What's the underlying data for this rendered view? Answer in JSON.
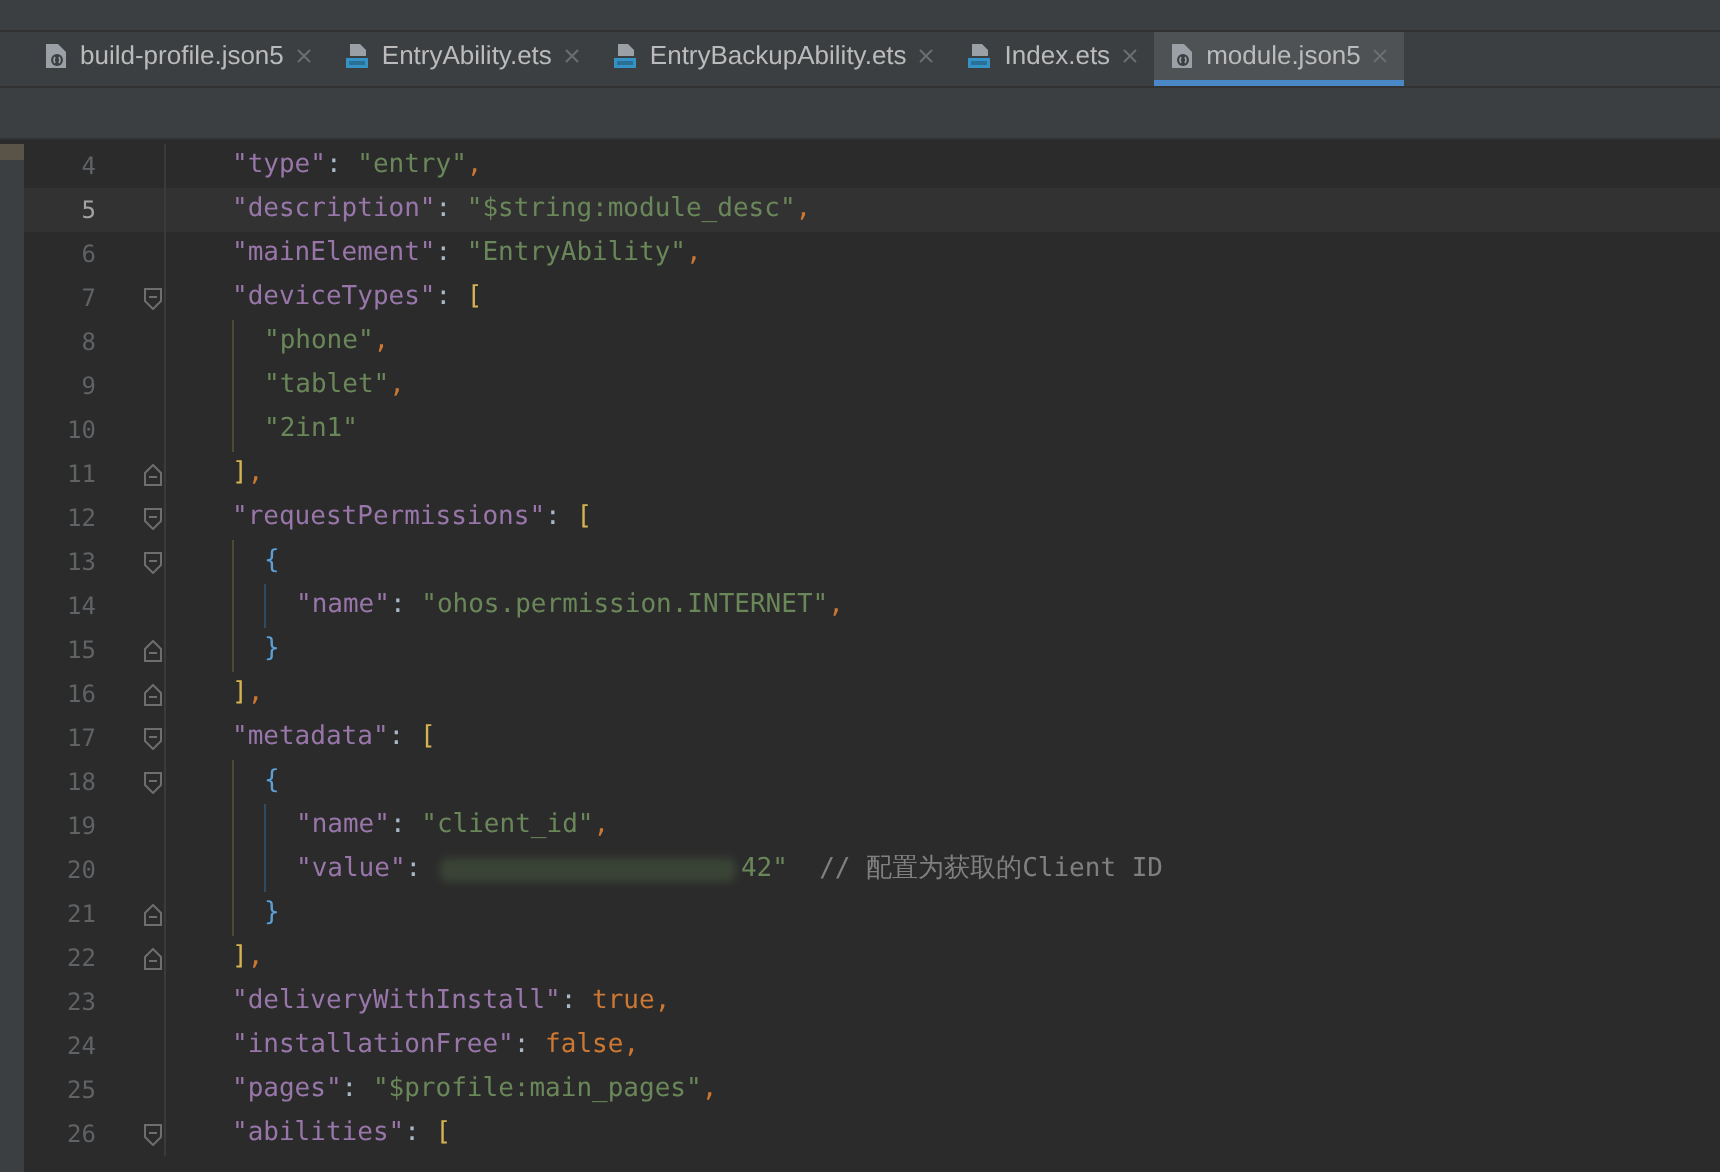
{
  "tabs": [
    {
      "label": "build-profile.json5",
      "kind": "json",
      "selected": false
    },
    {
      "label": "EntryAbility.ets",
      "kind": "ets",
      "selected": false
    },
    {
      "label": "EntryBackupAbility.ets",
      "kind": "ets",
      "selected": false
    },
    {
      "label": "Index.ets",
      "kind": "ets",
      "selected": false
    },
    {
      "label": "module.json5",
      "kind": "json",
      "selected": true
    }
  ],
  "editor": {
    "lines": [
      {
        "number": "4",
        "current": false,
        "tokens": [
          {
            "kind": "key",
            "text": "\"type\""
          },
          {
            "kind": "colon",
            "text": ": "
          },
          {
            "kind": "str",
            "text": "\"entry\""
          },
          {
            "kind": "comma",
            "text": ","
          }
        ]
      },
      {
        "number": "5",
        "current": true,
        "tokens": [
          {
            "kind": "key",
            "text": "\"description\""
          },
          {
            "kind": "colon",
            "text": ": "
          },
          {
            "kind": "str",
            "text": "\"$string:module_desc\""
          },
          {
            "kind": "comma",
            "text": ","
          }
        ]
      },
      {
        "number": "6",
        "current": false,
        "tokens": [
          {
            "kind": "key",
            "text": "\"mainElement\""
          },
          {
            "kind": "colon",
            "text": ": "
          },
          {
            "kind": "str",
            "text": "\"EntryAbility\""
          },
          {
            "kind": "comma",
            "text": ","
          }
        ]
      },
      {
        "number": "7",
        "current": false,
        "kind": "fold_open",
        "tokens": [
          {
            "kind": "key",
            "text": "\"deviceTypes\""
          },
          {
            "kind": "colon",
            "text": ": "
          },
          {
            "kind": "bracket",
            "text": "["
          }
        ],
        "children": [
          {
            "number": "8",
            "current": false,
            "tokens": [
              {
                "kind": "str",
                "text": "\"phone\""
              },
              {
                "kind": "comma",
                "text": ","
              }
            ]
          },
          {
            "number": "9",
            "current": false,
            "tokens": [
              {
                "kind": "str",
                "text": "\"tablet\""
              },
              {
                "kind": "comma",
                "text": ","
              }
            ]
          },
          {
            "number": "10",
            "current": false,
            "tokens": [
              {
                "kind": "str",
                "text": "\"2in1\""
              }
            ]
          }
        ]
      },
      {
        "number": "11",
        "current": false,
        "kind": "fold_close",
        "tokens": [
          {
            "kind": "bracket",
            "text": "]"
          },
          {
            "kind": "comma",
            "text": ","
          }
        ]
      },
      {
        "number": "12",
        "current": false,
        "kind": "fold_open",
        "tokens": [
          {
            "kind": "key",
            "text": "\"requestPermissions\""
          },
          {
            "kind": "colon",
            "text": ": "
          },
          {
            "kind": "bracket",
            "text": "["
          }
        ],
        "children": [
          {
            "number": "13",
            "current": false,
            "kind": "fold_open",
            "tokens": [
              {
                "kind": "brace",
                "text": "{"
              }
            ],
            "children": [
              {
                "number": "14",
                "current": false,
                "tokens": [
                  {
                    "kind": "key",
                    "text": "\"name\""
                  },
                  {
                    "kind": "colon",
                    "text": ": "
                  },
                  {
                    "kind": "str",
                    "text": "\"ohos.permission.INTERNET\""
                  },
                  {
                    "kind": "comma",
                    "text": ","
                  }
                ]
              }
            ]
          },
          {
            "number": "15",
            "current": false,
            "kind": "fold_close",
            "tokens": [
              {
                "kind": "brace",
                "text": "}"
              }
            ]
          }
        ]
      },
      {
        "number": "16",
        "current": false,
        "kind": "fold_close",
        "tokens": [
          {
            "kind": "bracket",
            "text": "]"
          },
          {
            "kind": "comma",
            "text": ","
          }
        ]
      },
      {
        "number": "17",
        "current": false,
        "kind": "fold_open",
        "tokens": [
          {
            "kind": "key",
            "text": "\"metadata\""
          },
          {
            "kind": "colon",
            "text": ": "
          },
          {
            "kind": "bracket",
            "text": "["
          }
        ],
        "children": [
          {
            "number": "18",
            "current": false,
            "kind": "fold_open",
            "tokens": [
              {
                "kind": "brace",
                "text": "{"
              }
            ],
            "children": [
              {
                "number": "19",
                "current": false,
                "tokens": [
                  {
                    "kind": "key",
                    "text": "\"name\""
                  },
                  {
                    "kind": "colon",
                    "text": ": "
                  },
                  {
                    "kind": "str",
                    "text": "\"client_id\""
                  },
                  {
                    "kind": "comma",
                    "text": ","
                  }
                ]
              },
              {
                "number": "20",
                "current": false,
                "tokens": [
                  {
                    "kind": "key",
                    "text": "\"value\""
                  },
                  {
                    "kind": "colon",
                    "text": ": "
                  },
                  {
                    "kind": "redacted"
                  },
                  {
                    "kind": "str",
                    "text": "42\""
                  },
                  {
                    "kind": "comment",
                    "text": "  // 配置为获取的Client ID"
                  }
                ]
              }
            ]
          },
          {
            "number": "21",
            "current": false,
            "kind": "fold_close",
            "tokens": [
              {
                "kind": "brace",
                "text": "}"
              }
            ]
          }
        ]
      },
      {
        "number": "22",
        "current": false,
        "kind": "fold_close",
        "tokens": [
          {
            "kind": "bracket",
            "text": "]"
          },
          {
            "kind": "comma",
            "text": ","
          }
        ]
      },
      {
        "number": "23",
        "current": false,
        "tokens": [
          {
            "kind": "key",
            "text": "\"deliveryWithInstall\""
          },
          {
            "kind": "colon",
            "text": ": "
          },
          {
            "kind": "bool",
            "text": "true"
          },
          {
            "kind": "comma",
            "text": ","
          }
        ]
      },
      {
        "number": "24",
        "current": false,
        "tokens": [
          {
            "kind": "key",
            "text": "\"installationFree\""
          },
          {
            "kind": "colon",
            "text": ": "
          },
          {
            "kind": "bool",
            "text": "false"
          },
          {
            "kind": "comma",
            "text": ","
          }
        ]
      },
      {
        "number": "25",
        "current": false,
        "tokens": [
          {
            "kind": "key",
            "text": "\"pages\""
          },
          {
            "kind": "colon",
            "text": ": "
          },
          {
            "kind": "str",
            "text": "\"$profile:main_pages\""
          },
          {
            "kind": "comma",
            "text": ","
          }
        ]
      },
      {
        "number": "26",
        "current": false,
        "kind": "fold_open",
        "tokens": [
          {
            "kind": "key",
            "text": "\"abilities\""
          },
          {
            "kind": "colon",
            "text": ": "
          },
          {
            "kind": "bracket",
            "text": "["
          }
        ]
      }
    ]
  }
}
